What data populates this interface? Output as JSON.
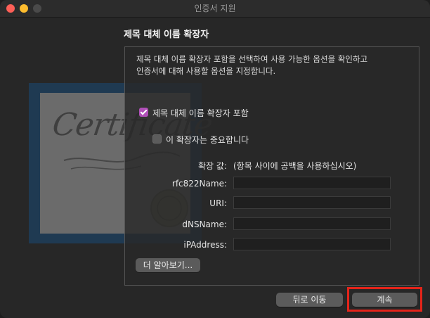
{
  "window": {
    "title": "인증서 지원"
  },
  "section": {
    "heading": "제목 대체 이름 확장자"
  },
  "description": {
    "line1": "제목 대체 이름 확장자 포함을 선택하여 사용 가능한 옵션을 확인하고",
    "line2": "인증서에 대해 사용할 옵션을 지정합니다."
  },
  "options": {
    "include_label": "제목 대체 이름 확장자 포함",
    "include_checked": true,
    "critical_label": "이 확장자는 중요합니다",
    "critical_checked": false
  },
  "extension": {
    "values_label": "확장 값:",
    "values_hint": "(항목 사이에 공백을 사용하십시오)"
  },
  "fields": {
    "rfc822_label": "rfc822Name:",
    "rfc822_value": "",
    "uri_label": "URI:",
    "uri_value": "",
    "dns_label": "dNSName:",
    "dns_value": "",
    "ip_label": "iPAddress:",
    "ip_value": ""
  },
  "buttons": {
    "learn_more": "더 알아보기...",
    "back": "뒤로 이동",
    "continue": "계속"
  },
  "colors": {
    "accent_checkbox": "#b04fb8",
    "highlight_border": "#e4241a",
    "close": "#fe5f57",
    "minimize": "#febc2e"
  }
}
